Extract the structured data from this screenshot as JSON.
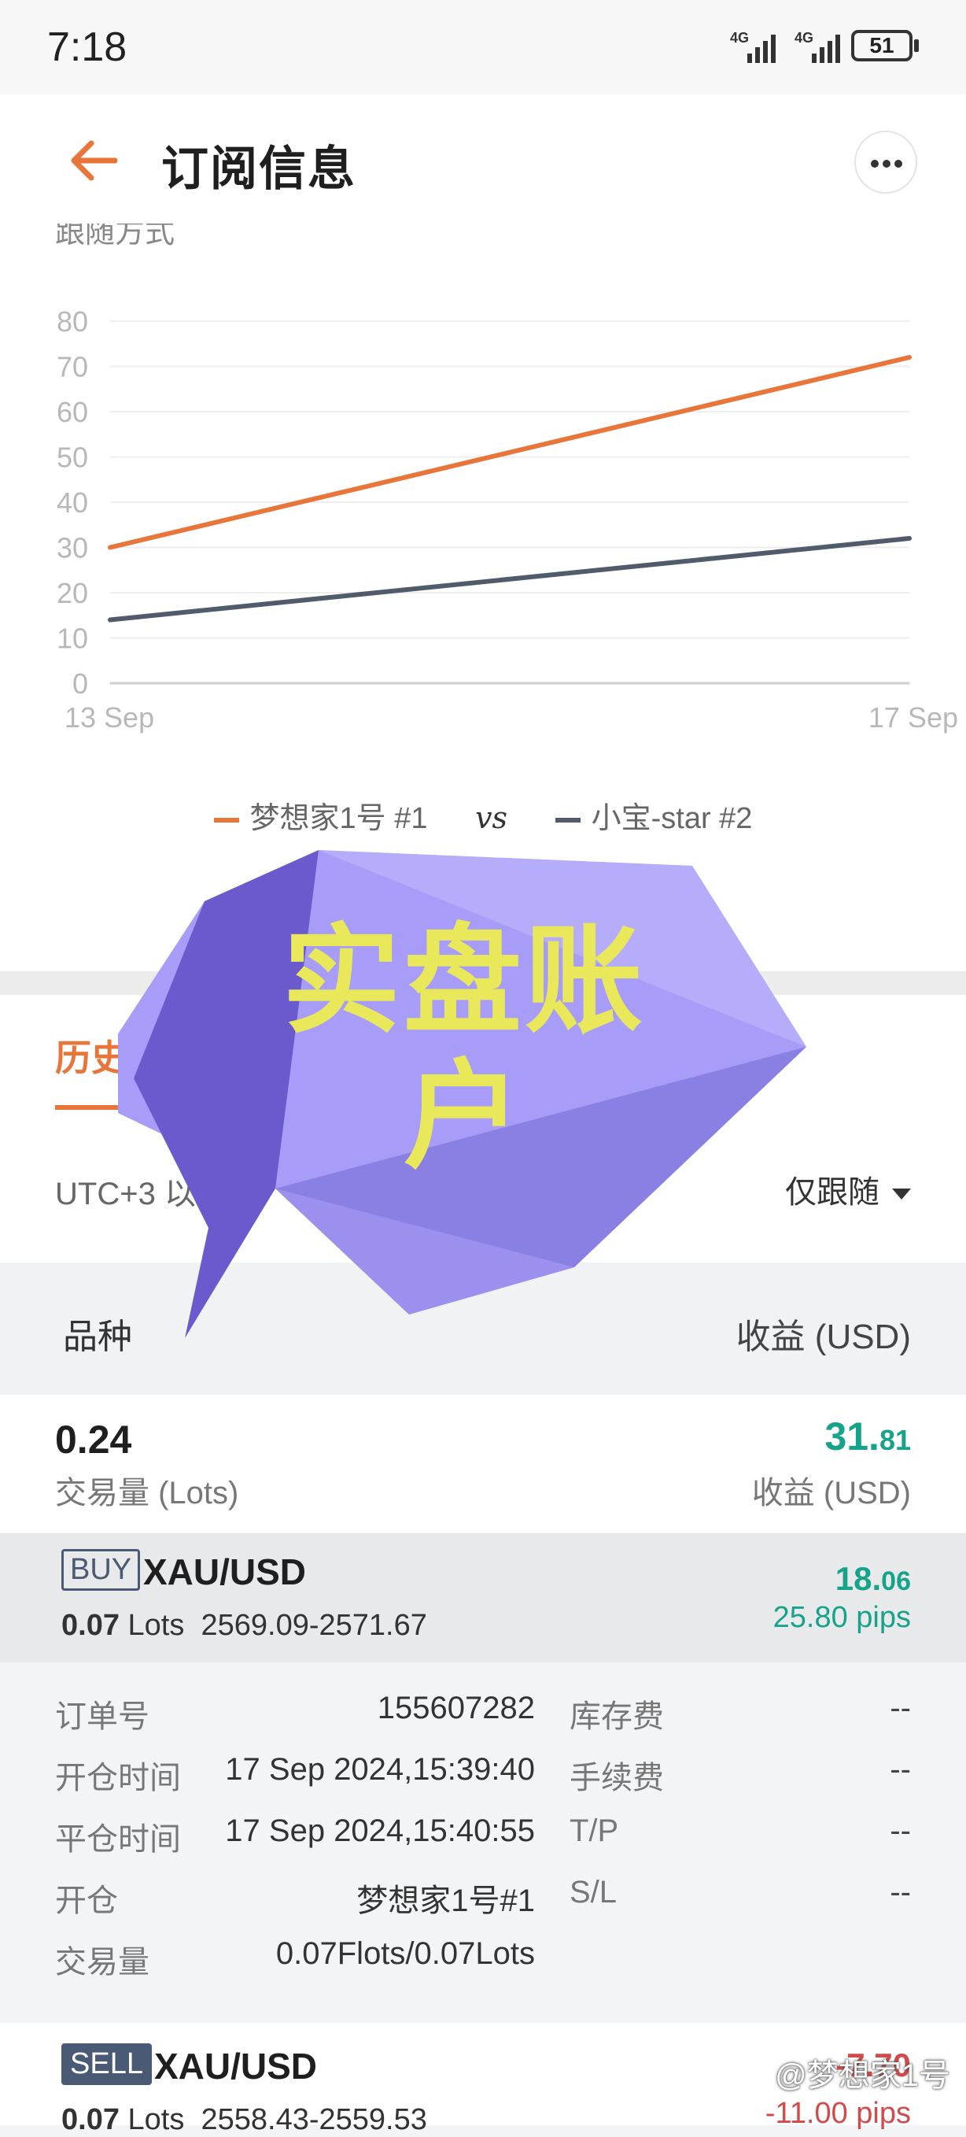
{
  "status_bar": {
    "time": "7:18",
    "signal_1": "4G",
    "signal_2": "4G",
    "battery": "51"
  },
  "header": {
    "title": "订阅信息",
    "back_icon": "arrow-left-icon",
    "more_icon": "more-dots-icon"
  },
  "chart_section": {
    "cut_label": "跟随方式"
  },
  "chart_data": {
    "type": "line",
    "x": [
      "13 Sep",
      "17 Sep"
    ],
    "ylim": [
      0,
      80
    ],
    "yticks": [
      0,
      10,
      20,
      30,
      40,
      50,
      60,
      70,
      80
    ],
    "series": [
      {
        "name": "梦想家1号 #1",
        "color": "#e8763a",
        "values": [
          30,
          72
        ]
      },
      {
        "name": "小宝-star #2",
        "color": "#525b6b",
        "values": [
          14,
          32
        ]
      }
    ],
    "grid": true,
    "legend": "bottom"
  },
  "legend": {
    "vs": "vs"
  },
  "tabs": {
    "history": "历史"
  },
  "filter": {
    "timezone": "UTC+3 以",
    "follow": "仅跟随"
  },
  "columns": {
    "left": "品种",
    "right": "收益 (USD)"
  },
  "summary": {
    "lots": "0.24",
    "lots_label": "交易量 (Lots)",
    "profit_int": "31.",
    "profit_dec": "81",
    "profit_label": "收益 (USD)"
  },
  "trade1": {
    "side": "BUY",
    "symbol": "XAU/USD",
    "lots": "0.07",
    "lots_unit": "Lots",
    "price_range": "2569.09-2571.67",
    "profit_int": "18.",
    "profit_dec": "06",
    "pips": "25.80 pips"
  },
  "details": [
    {
      "key": "订单号",
      "value": "155607282",
      "key2": "库存费",
      "value2": "--"
    },
    {
      "key": "开仓时间",
      "value": "17 Sep 2024,15:39:40",
      "key2": "手续费",
      "value2": "--"
    },
    {
      "key": "平仓时间",
      "value": "17 Sep 2024,15:40:55",
      "key2": "T/P",
      "value2": "--"
    },
    {
      "key": "开仓",
      "value": "梦想家1号#1",
      "key2": "S/L",
      "value2": "--"
    },
    {
      "key": "交易量",
      "value": "0.07Flots/0.07Lots",
      "key2": "",
      "value2": ""
    }
  ],
  "trade2": {
    "side": "SELL",
    "symbol": "XAU/USD",
    "lots": "0.07",
    "lots_unit": "Lots",
    "price_range": "2558.43-2559.53",
    "profit": "-7.70",
    "pips": "-11.00 pips"
  },
  "overlay": {
    "text_line1": "实盘账",
    "text_line2": "户"
  },
  "watermark": "@梦想家1号"
}
